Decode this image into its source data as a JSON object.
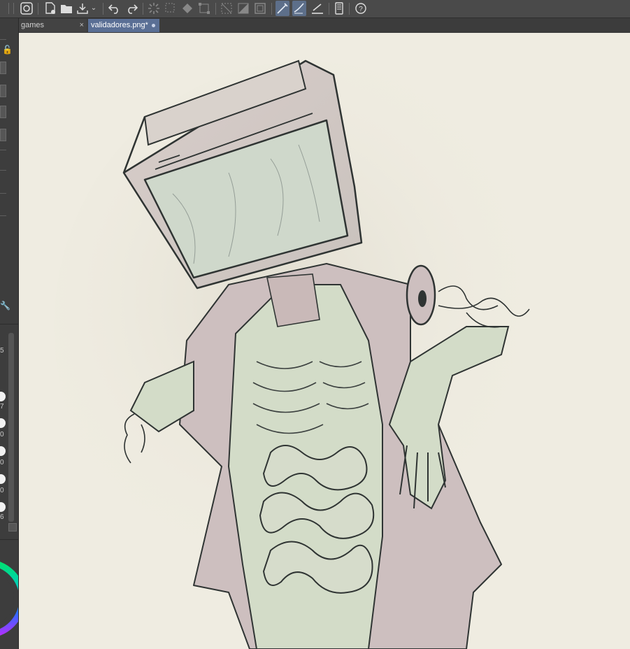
{
  "toolbar": {
    "icons": [
      "app-logo-icon",
      "new-file-icon",
      "open-folder-icon",
      "save-export-icon",
      "undo-icon",
      "redo-icon",
      "busy-spinner-icon",
      "selection-icon",
      "fill-icon",
      "transform-icon",
      "grid-icon",
      "invert-icon",
      "frame-icon",
      "vector-pen-icon",
      "curve-pen-icon",
      "ruler-pen-icon",
      "tablet-icon",
      "help-icon"
    ]
  },
  "tabs": {
    "games": {
      "label": "games",
      "close": "×"
    },
    "validadores": {
      "label": "validadores.png*"
    }
  },
  "left_panel": {
    "values": [
      "5",
      "7",
      "0",
      "0",
      "0",
      "6"
    ]
  },
  "canvas": {
    "background": "#efece1"
  },
  "colors": {
    "tab_active": "#5a6f95",
    "toolbar": "#4a4a4a"
  }
}
